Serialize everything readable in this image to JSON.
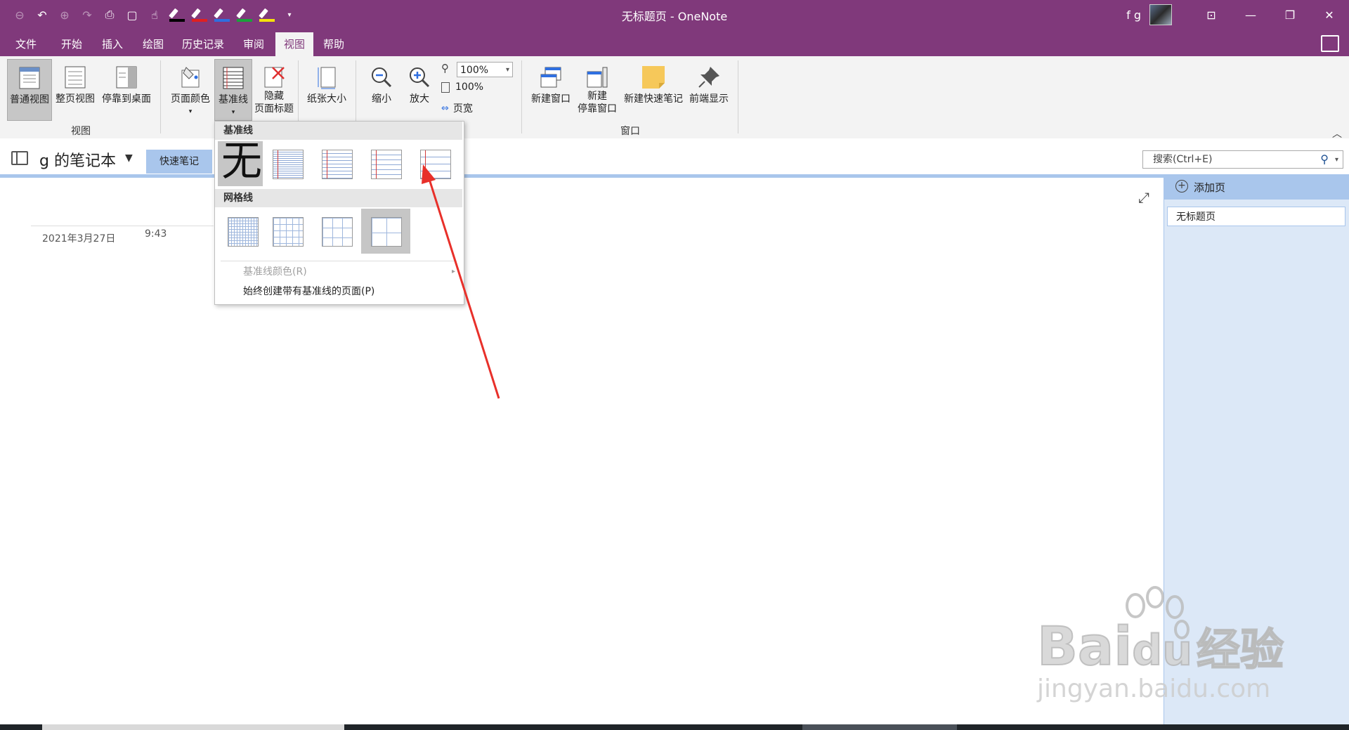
{
  "window": {
    "title": "无标题页 - OneNote",
    "user": "f g"
  },
  "ribbon_tabs": [
    {
      "label": "文件",
      "active": false
    },
    {
      "label": "开始",
      "active": false
    },
    {
      "label": "插入",
      "active": false
    },
    {
      "label": "绘图",
      "active": false
    },
    {
      "label": "历史记录",
      "active": false
    },
    {
      "label": "审阅",
      "active": false
    },
    {
      "label": "视图",
      "active": true
    },
    {
      "label": "帮助",
      "active": false
    }
  ],
  "ribbon": {
    "view_group": {
      "label": "视图",
      "normal_view": "普通视图",
      "full_page_view": "整页视图",
      "dock_to_desktop": "停靠到桌面"
    },
    "page_setup": {
      "page_color": "页面颜色",
      "rule_lines": "基准线",
      "hide_page_title_1": "隐藏",
      "hide_page_title_2": "页面标题",
      "paper_size": "纸张大小"
    },
    "zoom": {
      "zoom_out": "缩小",
      "zoom_in": "放大",
      "zoom_value": "100%",
      "zoom_100": "100%",
      "page_width": "页宽"
    },
    "window_group": {
      "label": "窗口",
      "new_window": "新建窗口",
      "new_docked_window_1": "新建",
      "new_docked_window_2": "停靠窗口",
      "new_quick_note": "新建快速笔记",
      "always_on_top": "前端显示"
    }
  },
  "notebook": {
    "name": "g 的笔记本",
    "section_tab": "快速笔记"
  },
  "search": {
    "placeholder": "搜索(Ctrl+E)"
  },
  "page": {
    "date": "2021年3月27日",
    "time": "9:43"
  },
  "page_pane": {
    "add_page": "添加页",
    "pages": [
      "无标题页"
    ]
  },
  "rule_lines_menu": {
    "rule_lines_header": "基准线",
    "none_label": "无",
    "grid_lines_header": "网格线",
    "rule_line_color": "基准线颜色(R)",
    "always_create": "始终创建带有基准线的页面(P)"
  },
  "watermark": {
    "brand": "Bai",
    "brand_du": "du",
    "brand_cn": "经验",
    "url": "jingyan.baidu.com"
  },
  "colors": {
    "title_bar": "#80397b",
    "ribbon": "#f3f3f3",
    "section_blue": "#a9c6ec",
    "pane_bg": "#dce8f7",
    "annotation_arrow": "#e8302a"
  },
  "icons": [
    "back-icon",
    "undo-icon",
    "forward-icon",
    "redo-icon",
    "print-icon",
    "print-preview-icon",
    "touch-mode-icon",
    "pen-black-icon",
    "pen-red-icon",
    "pen-blue-icon",
    "pen-green-icon",
    "highlighter-yellow-icon",
    "customize-qat-icon"
  ]
}
